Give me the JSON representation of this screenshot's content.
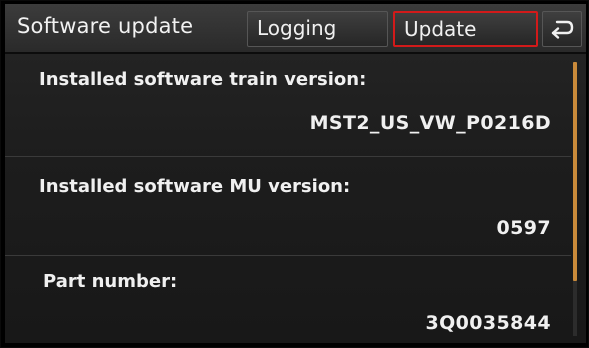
{
  "header": {
    "title": "Software update",
    "tabs": [
      {
        "label": "Logging",
        "selected": false
      },
      {
        "label": "Update",
        "selected": true
      }
    ],
    "back_icon": "return-arrow-icon"
  },
  "rows": [
    {
      "label": "Installed software train version:",
      "value": "MST2_US_VW_P0216D"
    },
    {
      "label": "Installed software MU version:",
      "value": "0597"
    },
    {
      "label": "Part number:",
      "value": "3Q0035844"
    }
  ],
  "colors": {
    "selected_border": "#d21a1a",
    "scroll_thumb": "#c98a3a",
    "background": "#1d1d1d"
  },
  "scroll": {
    "visible_fraction": 0.8
  }
}
